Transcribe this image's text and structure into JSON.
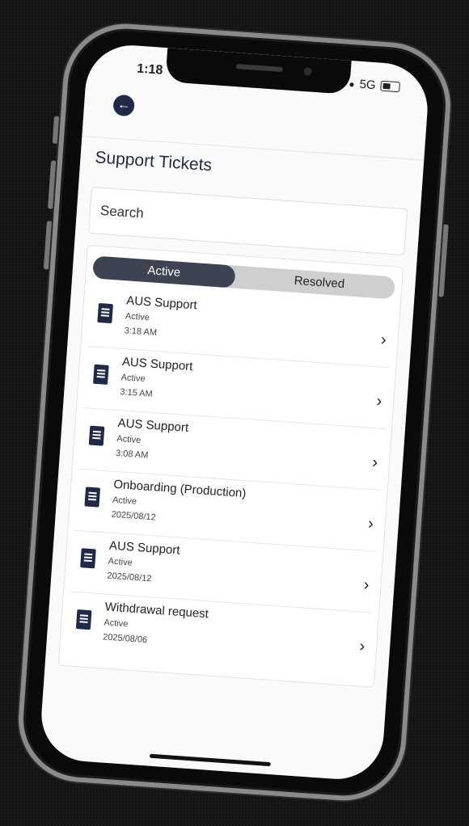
{
  "status_bar": {
    "time": "1:18",
    "network": "5G"
  },
  "header": {
    "back_icon": "arrow-left-icon",
    "title": "Support Tickets"
  },
  "search": {
    "placeholder": "Search"
  },
  "tabs": [
    {
      "label": "Active",
      "selected": true
    },
    {
      "label": "Resolved",
      "selected": false
    }
  ],
  "tickets": [
    {
      "title": "AUS Support",
      "status": "Active",
      "time": "3:18 AM"
    },
    {
      "title": "AUS Support",
      "status": "Active",
      "time": "3:15 AM"
    },
    {
      "title": "AUS Support",
      "status": "Active",
      "time": "3:08 AM"
    },
    {
      "title": "Onboarding (Production)",
      "status": "Active",
      "time": "2025/08/12"
    },
    {
      "title": "AUS Support",
      "status": "Active",
      "time": "2025/08/12"
    },
    {
      "title": "Withdrawal request",
      "status": "Active",
      "time": "2025/08/06"
    }
  ],
  "colors": {
    "accent": "#1f2a4a",
    "tab_active": "#3d4350",
    "tab_bg": "#cfcfcf"
  }
}
